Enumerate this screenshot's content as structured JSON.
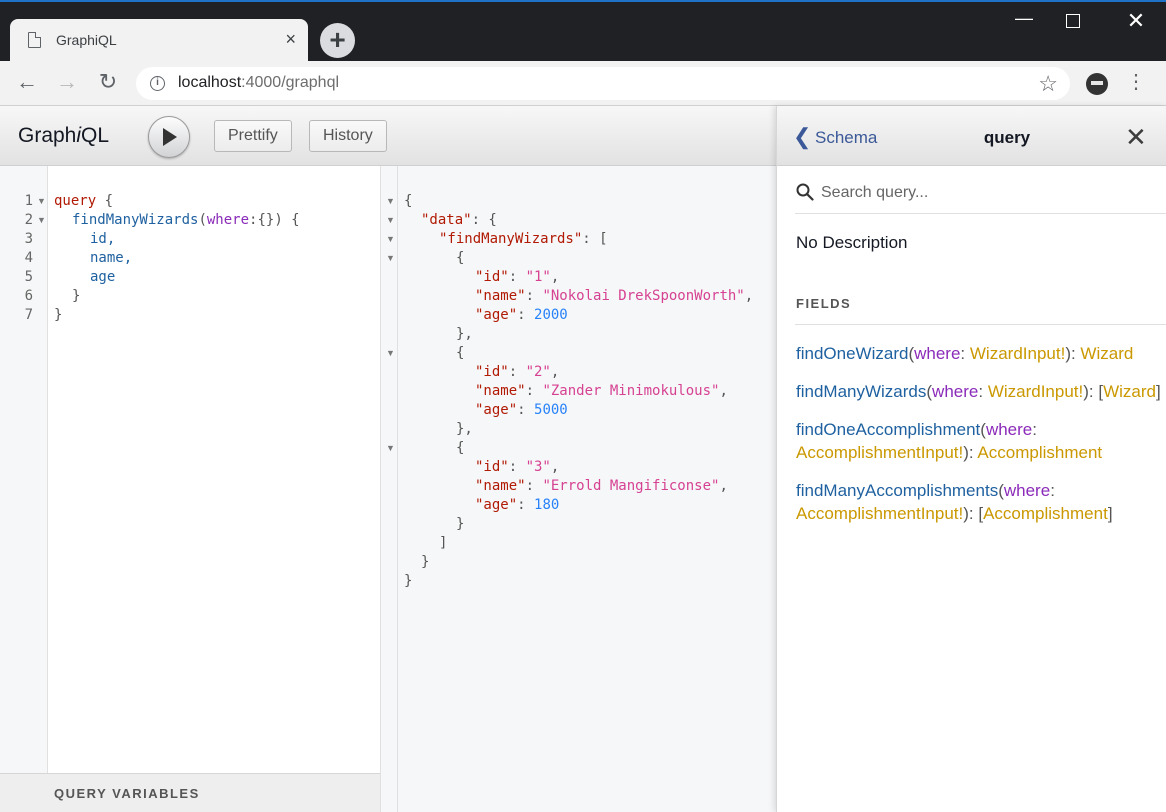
{
  "browser": {
    "tab_title": "GraphiQL",
    "tab_close": "×",
    "new_tab": "+",
    "url_host": "localhost",
    "url_rest": ":4000/graphql",
    "icons": [
      "page-icon",
      "close-icon",
      "plus-icon",
      "minimize-icon",
      "maximize-icon",
      "close-window-icon",
      "back-arrow-icon",
      "forward-arrow-icon",
      "reload-icon",
      "info-icon",
      "star-icon",
      "avatar",
      "kebab-menu-icon"
    ]
  },
  "graphiql": {
    "title_pre": "Graph",
    "title_i": "i",
    "title_post": "QL",
    "prettify_label": "Prettify",
    "history_label": "History",
    "query_variables_label": "QUERY VARIABLES"
  },
  "query_editor": {
    "line_numbers": [
      "1",
      "2",
      "3",
      "4",
      "5",
      "6",
      "7"
    ],
    "lines": {
      "l1_kw": "query",
      "l1_brace": " {",
      "l2_field": "findManyWizards",
      "l2_open": "(",
      "l2_arg": "where",
      "l2_rest": ":{}) {",
      "l3": "id,",
      "l4": "name,",
      "l5": "age",
      "l6": "}",
      "l7": "}"
    }
  },
  "result": {
    "open_root": "{",
    "data_key": "\"data\"",
    "fmw_key": "\"findManyWizards\"",
    "items": [
      {
        "id_key": "\"id\"",
        "id": "\"1\"",
        "name_key": "\"name\"",
        "name": "\"Nokolai DrekSpoonWorth\"",
        "age_key": "\"age\"",
        "age": "2000"
      },
      {
        "id_key": "\"id\"",
        "id": "\"2\"",
        "name_key": "\"name\"",
        "name": "\"Zander Minimokulous\"",
        "age_key": "\"age\"",
        "age": "5000"
      },
      {
        "id_key": "\"id\"",
        "id": "\"3\"",
        "name_key": "\"name\"",
        "name": "\"Errold Mangificonse\"",
        "age_key": "\"age\"",
        "age": "180"
      }
    ]
  },
  "doc_explorer": {
    "back_label": "Schema",
    "title": "query",
    "search_placeholder": "Search query...",
    "description": "No Description",
    "fields_heading": "FIELDS",
    "fields": [
      {
        "name": "findOneWizard",
        "arg": "where",
        "arg_type": "WizardInput!",
        "type_pre": "",
        "type": "Wizard",
        "type_post": ""
      },
      {
        "name": "findManyWizards",
        "arg": "where",
        "arg_type": "WizardInput!",
        "type_pre": "[",
        "type": "Wizard",
        "type_post": "]"
      },
      {
        "name": "findOneAccomplishment",
        "arg": "where",
        "arg_type": "AccomplishmentInput!",
        "type_pre": "",
        "type": "Accomplishment",
        "type_post": ""
      },
      {
        "name": "findManyAccomplishments",
        "arg": "where",
        "arg_type": "AccomplishmentInput!",
        "type_pre": "[",
        "type": "Accomplishment",
        "type_post": "]"
      }
    ]
  }
}
